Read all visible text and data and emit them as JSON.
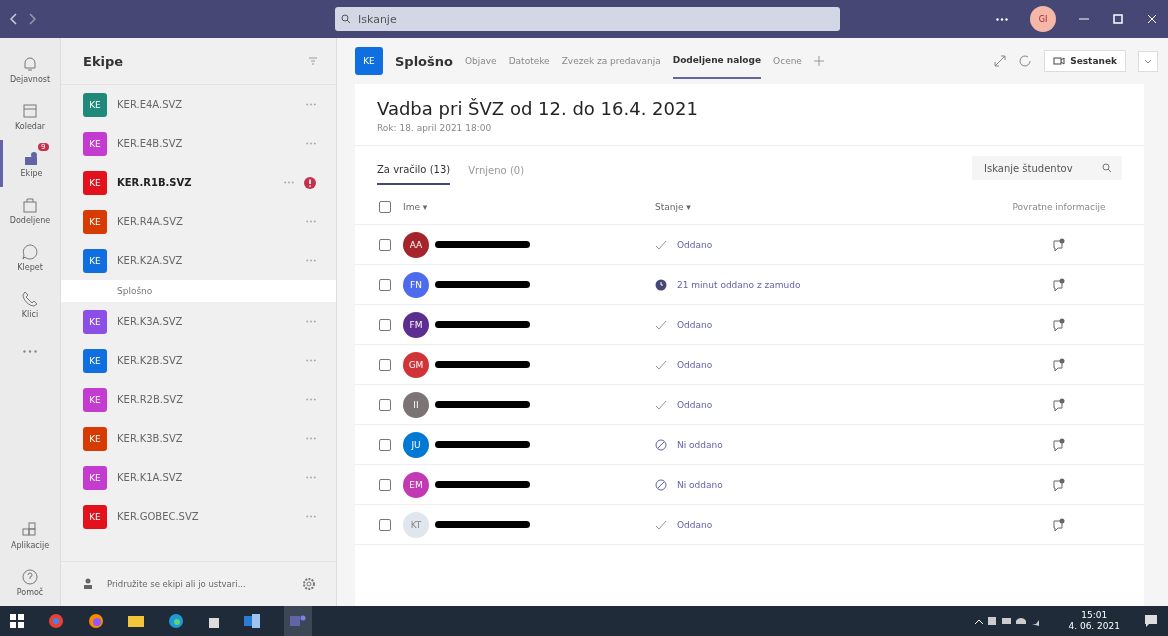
{
  "titlebar": {
    "search": {
      "placeholder": "Iskanje"
    },
    "avatar": "GI"
  },
  "rail": [
    {
      "label": "Dejavnost",
      "selected": false
    },
    {
      "label": "Koledar",
      "selected": false
    },
    {
      "label": "Ekipe",
      "selected": true,
      "badge": "9"
    },
    {
      "label": "Dodeljene",
      "selected": false
    },
    {
      "label": "Klepet",
      "selected": false
    },
    {
      "label": "Klici",
      "selected": false
    }
  ],
  "rail_bottom": [
    {
      "label": "Aplikacije"
    },
    {
      "label": "Pomoč"
    }
  ],
  "teams_panel": {
    "title": "Ekipe",
    "teams": [
      {
        "initials": "KE",
        "name": "KER.E4A.SVZ",
        "color": "#1f8a7a",
        "bold": false,
        "alert": false
      },
      {
        "initials": "KE",
        "name": "KER.E4B.SVZ",
        "color": "#c43bcf",
        "bold": false,
        "alert": false
      },
      {
        "initials": "KE",
        "name": "KER.R1B.SVZ",
        "color": "#e3111b",
        "bold": true,
        "alert": true
      },
      {
        "initials": "KE",
        "name": "KER.R4A.SVZ",
        "color": "#d83b01",
        "bold": false,
        "alert": false
      },
      {
        "initials": "KE",
        "name": "KER.K2A.SVZ",
        "color": "#0f6fe0",
        "bold": false,
        "alert": false,
        "channels": [
          {
            "name": "Splošno",
            "selected": true
          }
        ]
      },
      {
        "initials": "KE",
        "name": "KER.K3A.SVZ",
        "color": "#8b4fe8",
        "bold": false,
        "alert": false
      },
      {
        "initials": "KE",
        "name": "KER.K2B.SVZ",
        "color": "#0f6fe0",
        "bold": false,
        "alert": false
      },
      {
        "initials": "KE",
        "name": "KER.R2B.SVZ",
        "color": "#c43bcf",
        "bold": false,
        "alert": false
      },
      {
        "initials": "KE",
        "name": "KER.K3B.SVZ",
        "color": "#d83b01",
        "bold": false,
        "alert": false
      },
      {
        "initials": "KE",
        "name": "KER.K1A.SVZ",
        "color": "#c43bcf",
        "bold": false,
        "alert": false
      },
      {
        "initials": "KE",
        "name": "KER.GOBEC.SVZ",
        "color": "#e3111b",
        "bold": false,
        "alert": false
      }
    ],
    "join": "Pridružite se ekipi ali jo ustvari..."
  },
  "channel_header": {
    "initials": "KE",
    "name": "Splošno",
    "tabs": [
      {
        "label": "Objave",
        "selected": false
      },
      {
        "label": "Datoteke",
        "selected": false
      },
      {
        "label": "Zvezek za predavanja",
        "selected": false
      },
      {
        "label": "Dodeljene naloge",
        "selected": true
      },
      {
        "label": "Ocene",
        "selected": false
      }
    ],
    "meet": "Sestanek"
  },
  "assignment": {
    "title": "Vadba pri ŠVZ od 12. do 16.4. 2021",
    "due": "Rok: 18. april 2021 18:00",
    "tabs": [
      {
        "label": "Za vračilo (13)",
        "selected": true
      },
      {
        "label": "Vrnjeno (0)",
        "selected": false
      }
    ],
    "search": {
      "placeholder": "Iskanje študentov"
    },
    "select_all_checked": false,
    "columns": [
      "Ime ▾",
      "Stanje ▾",
      "Povratne informacije"
    ],
    "rows": [
      {
        "initials": "AA",
        "color": "#a4262c",
        "status": "Oddano",
        "kind": "submitted",
        "checked": false
      },
      {
        "initials": "FN",
        "color": "#4f6bed",
        "status": "21 minut oddano z zamudo",
        "kind": "late",
        "checked": false
      },
      {
        "initials": "FM",
        "color": "#5c2e91",
        "status": "Oddano",
        "kind": "submitted",
        "checked": false
      },
      {
        "initials": "GM",
        "color": "#d13438",
        "status": "Oddano",
        "kind": "submitted",
        "checked": false
      },
      {
        "initials": "II",
        "color": "#7a7574",
        "status": "Oddano",
        "kind": "submitted",
        "checked": false
      },
      {
        "initials": "JU",
        "color": "#0078d4",
        "status": "Ni oddano",
        "kind": "missing",
        "checked": false
      },
      {
        "initials": "EM",
        "color": "#c239b3",
        "status": "Ni oddano",
        "kind": "missing",
        "checked": false
      },
      {
        "initials": "KT",
        "color": "#dfe6ee",
        "status": "Oddano",
        "kind": "submitted",
        "checked": false
      }
    ]
  },
  "taskbar": {
    "time": "15:01",
    "date": "4. 06. 2021"
  }
}
